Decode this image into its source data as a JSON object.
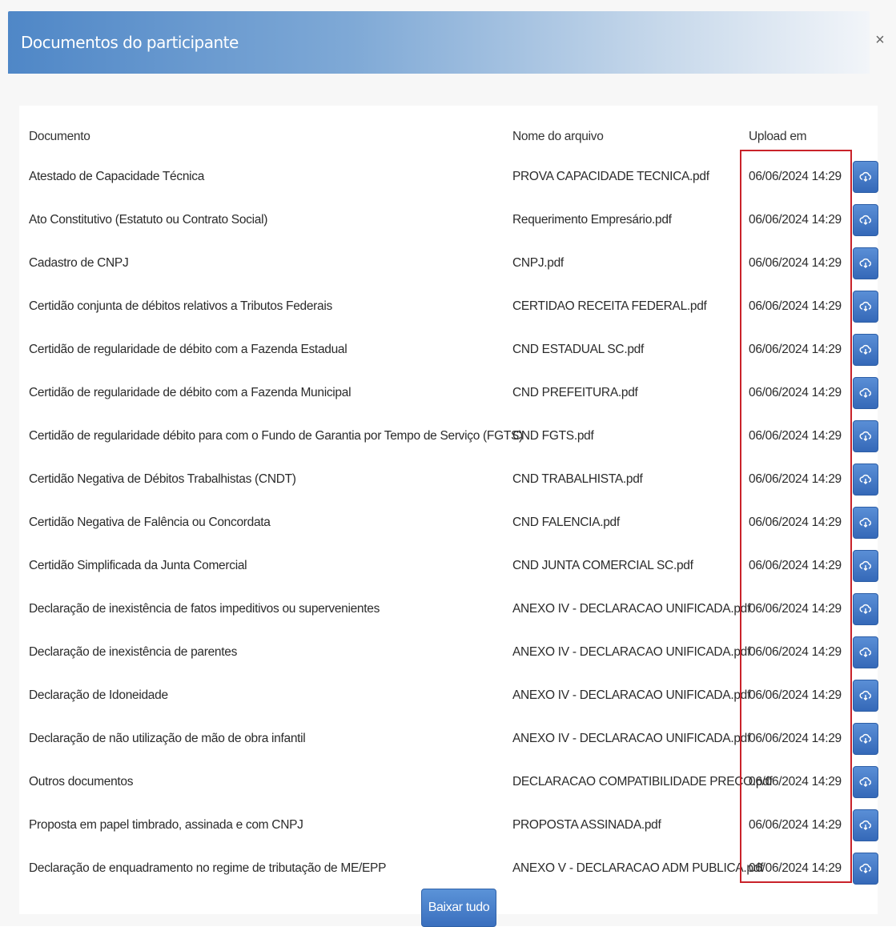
{
  "modal": {
    "title": "Documentos do participante",
    "close_glyph": "×"
  },
  "table": {
    "headers": {
      "document": "Documento",
      "file": "Nome do arquivo",
      "upload": "Upload em"
    },
    "rows": [
      {
        "document": "Atestado de Capacidade Técnica",
        "file": "PROVA CAPACIDADE TECNICA.pdf",
        "date": "06/06/2024 14:29"
      },
      {
        "document": "Ato Constitutivo (Estatuto ou Contrato Social)",
        "file": "Requerimento Empresário.pdf",
        "date": "06/06/2024 14:29"
      },
      {
        "document": "Cadastro de CNPJ",
        "file": "CNPJ.pdf",
        "date": "06/06/2024 14:29"
      },
      {
        "document": "Certidão conjunta de débitos relativos a Tributos Federais",
        "file": "CERTIDAO RECEITA FEDERAL.pdf",
        "date": "06/06/2024 14:29"
      },
      {
        "document": "Certidão de regularidade de débito com a Fazenda Estadual",
        "file": "CND ESTADUAL SC.pdf",
        "date": "06/06/2024 14:29"
      },
      {
        "document": "Certidão de regularidade de débito com a Fazenda Municipal",
        "file": "CND PREFEITURA.pdf",
        "date": "06/06/2024 14:29"
      },
      {
        "document": "Certidão de regularidade débito para com o Fundo de Garantia por Tempo de Serviço (FGTS)",
        "file": "CND FGTS.pdf",
        "date": "06/06/2024 14:29"
      },
      {
        "document": "Certidão Negativa de Débitos Trabalhistas (CNDT)",
        "file": "CND TRABALHISTA.pdf",
        "date": "06/06/2024 14:29"
      },
      {
        "document": "Certidão Negativa de Falência ou Concordata",
        "file": "CND FALENCIA.pdf",
        "date": "06/06/2024 14:29"
      },
      {
        "document": "Certidão Simplificada da Junta Comercial",
        "file": "CND JUNTA COMERCIAL SC.pdf",
        "date": "06/06/2024 14:29"
      },
      {
        "document": "Declaração de inexistência de fatos impeditivos ou supervenientes",
        "file": "ANEXO IV - DECLARACAO UNIFICADA.pdf",
        "date": "06/06/2024 14:29"
      },
      {
        "document": "Declaração de inexistência de parentes",
        "file": "ANEXO IV - DECLARACAO UNIFICADA.pdf",
        "date": "06/06/2024 14:29"
      },
      {
        "document": "Declaração de Idoneidade",
        "file": "ANEXO IV - DECLARACAO UNIFICADA.pdf",
        "date": "06/06/2024 14:29"
      },
      {
        "document": "Declaração de não utilização de mão de obra infantil",
        "file": "ANEXO IV - DECLARACAO UNIFICADA.pdf",
        "date": "06/06/2024 14:29"
      },
      {
        "document": "Outros documentos",
        "file": "DECLARACAO COMPATIBILIDADE PRECO.pdf",
        "date": "06/06/2024 14:29"
      },
      {
        "document": "Proposta em papel timbrado, assinada e com CNPJ",
        "file": "PROPOSTA ASSINADA.pdf",
        "date": "06/06/2024 14:29"
      },
      {
        "document": "Declaração de enquadramento no regime de tributação de ME/EPP",
        "file": "ANEXO V - DECLARACAO ADM PUBLICA.pdf",
        "date": "06/06/2024 14:29"
      }
    ]
  },
  "row_action_icon": "cloud-download-icon",
  "footer": {
    "download_all_label": "Baixar tudo"
  },
  "colors": {
    "header_blue": "#4f87c7",
    "button_blue": "#3a6fbe",
    "highlight_red": "#c9222a"
  }
}
